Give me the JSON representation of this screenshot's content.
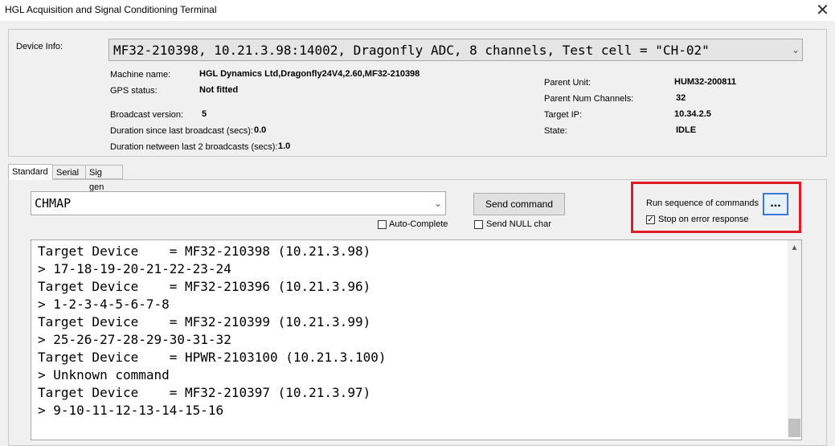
{
  "window": {
    "title": "HGL Acquisition and Signal Conditioning Terminal",
    "close_glyph": "✕"
  },
  "device_info": {
    "label": "Device Info:",
    "selected": "MF32-210398, 10.21.3.98:14002, Dragonfly ADC, 8 channels, Test cell = \"CH-02\"",
    "left_fields": [
      {
        "label": "Machine name:",
        "value": "HGL Dynamics Ltd,Dragonfly24V4,2.60,MF32-210398"
      },
      {
        "label": "GPS status:",
        "value": "Not fitted"
      },
      {
        "label": "Broadcast version:",
        "value": "5"
      },
      {
        "label": "Duration since last broadcast (secs):",
        "value": "0.0"
      },
      {
        "label": "Duration netween last 2 broadcasts (secs):",
        "value": "1.0"
      }
    ],
    "right_fields": [
      {
        "label": "Parent Unit:",
        "value": "HUM32-200811"
      },
      {
        "label": "Parent Num Channels:",
        "value": "32"
      },
      {
        "label": "Target IP:",
        "value": "10.34.2.5"
      },
      {
        "label": "State:",
        "value": "IDLE"
      }
    ]
  },
  "tabs": [
    {
      "label": "Standard",
      "active": true
    },
    {
      "label": "Serial",
      "active": false
    },
    {
      "label": "Sig gen",
      "active": false
    }
  ],
  "command": {
    "value": "CHMAP",
    "auto_complete_label": "Auto-Complete",
    "auto_complete_checked": false,
    "send_label": "Send command",
    "send_null_label": "Send NULL char",
    "send_null_checked": false
  },
  "sequence": {
    "label": "Run sequence of commands",
    "button_label": "...",
    "stop_on_error_label": "Stop on error response",
    "stop_on_error_checked": true,
    "highlight_color": "#e01b24"
  },
  "output_lines": [
    "Target Device    = MF32-210398 (10.21.3.98)",
    "> 17-18-19-20-21-22-23-24",
    "Target Device    = MF32-210396 (10.21.3.96)",
    "> 1-2-3-4-5-6-7-8",
    "Target Device    = MF32-210399 (10.21.3.99)",
    "> 25-26-27-28-29-30-31-32",
    "Target Device    = HPWR-2103100 (10.21.3.100)",
    "> Unknown command",
    "Target Device    = MF32-210397 (10.21.3.97)",
    "> 9-10-11-12-13-14-15-16"
  ],
  "icons": {
    "dropdown": "chevron-down-icon",
    "check": "checkmark-icon",
    "scroll_up": "chevron-up-icon"
  }
}
